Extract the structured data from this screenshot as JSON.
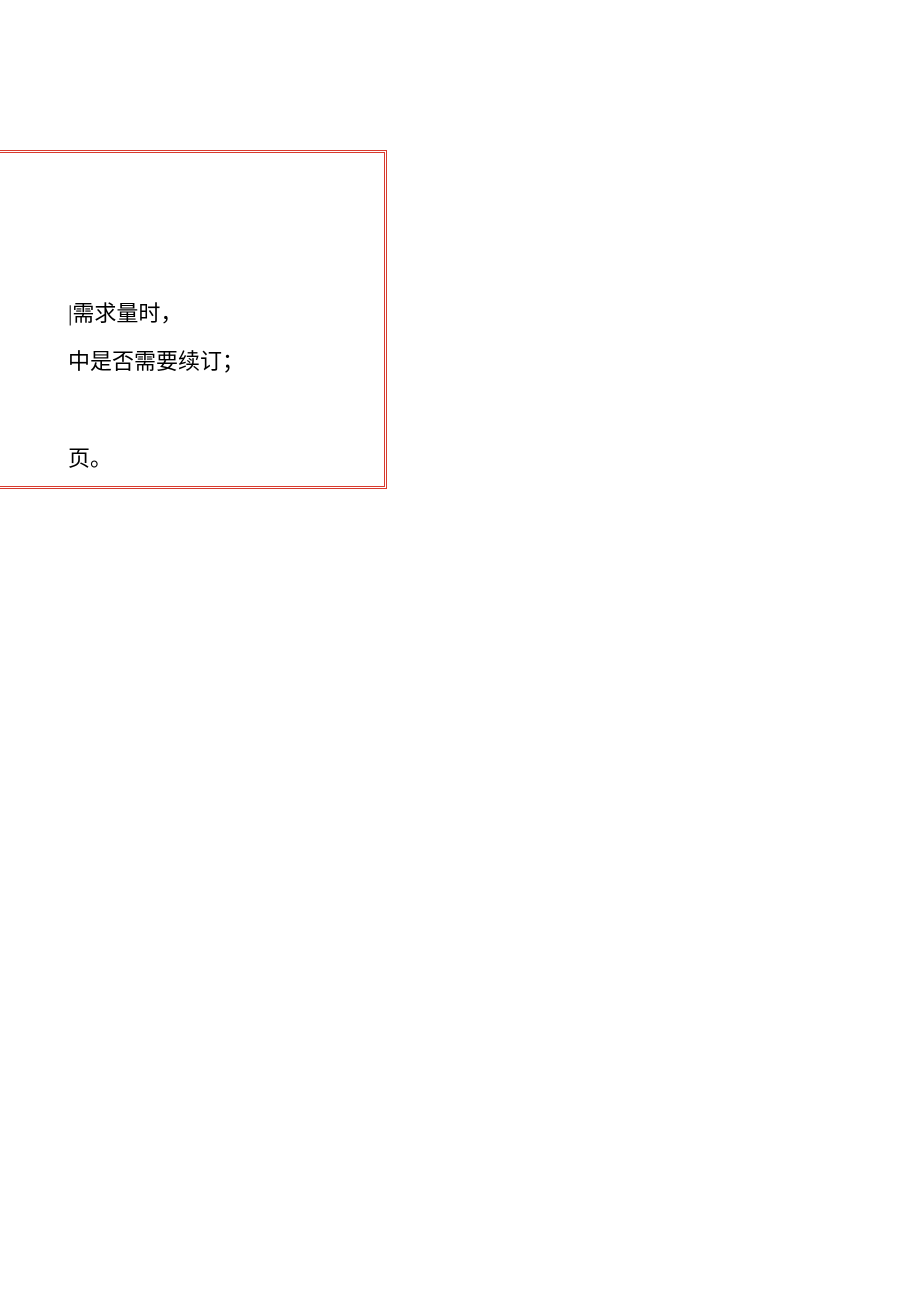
{
  "document": {
    "lines": [
      "|需求量时，",
      "中是否需要续订；",
      "页。"
    ]
  }
}
